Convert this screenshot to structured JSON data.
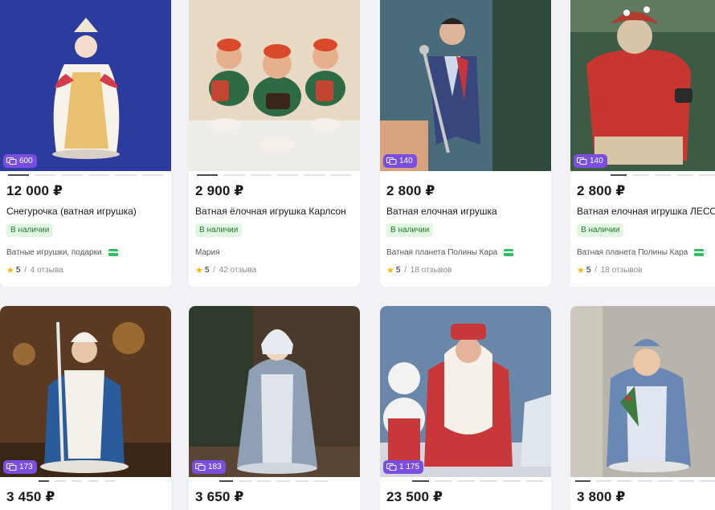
{
  "products": [
    {
      "price": "12 000 ₽",
      "title": "Снегурочка (ватная игрушка)",
      "stock": "В наличии",
      "seller": "Ватные игрушки, подарки",
      "rating": "5",
      "reviews": "4 отзыва",
      "photo_count": "600",
      "image": "snegurochka-toy-photo"
    },
    {
      "price": "2 900 ₽",
      "title": "Ватная ёлочная игрушка Карлсон",
      "stock": "В наличии",
      "seller": "Мария",
      "rating": "5",
      "reviews": "42 отзыва",
      "photo_count": "",
      "image": "carlson-toys-photo"
    },
    {
      "price": "2 800 ₽",
      "title": "Ватная елочная игрушка",
      "stock": "В наличии",
      "seller": "Ватная планета Полины Кара",
      "rating": "5",
      "reviews": "18 отзывов",
      "photo_count": "140",
      "image": "singer-toy-photo"
    },
    {
      "price": "2 800 ₽",
      "title": "Ватная елочная игрушка ЛЕСО",
      "stock": "В наличии",
      "seller": "Ватная планета Полины Кара",
      "rating": "5",
      "reviews": "18 отзывов",
      "photo_count": "140",
      "image": "leshy-toy-photo"
    },
    {
      "price": "3 450 ₽",
      "photo_count": "173",
      "image": "ded-moroz-blue-photo"
    },
    {
      "price": "3 650 ₽",
      "photo_count": "183",
      "image": "snegurochka-grey-photo"
    },
    {
      "price": "23 500 ₽",
      "photo_count": "1 175",
      "image": "ded-moroz-snowman-photo"
    },
    {
      "price": "3 800 ₽",
      "photo_count": "",
      "image": "snegurochka-blue-photo"
    }
  ],
  "colors": {
    "badge": "#7a4fe0",
    "stock_bg": "#e3f6e3",
    "stock_text": "#1f7a2a",
    "star": "#f5b800"
  }
}
